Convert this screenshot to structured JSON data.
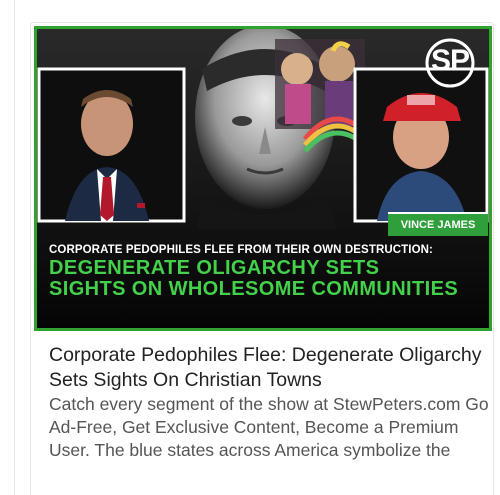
{
  "thumbnail": {
    "logo_text": "SP",
    "name_tag": "VINCE JAMES",
    "headline_line1": "CORPORATE PEDOPHILES FLEE FROM THEIR OWN DESTRUCTION:",
    "headline_line2": "DEGENERATE OLIGARCHY SETS",
    "headline_line3": "SIGHTS ON WHOLESOME COMMUNITIES",
    "colors": {
      "frame": "#2fa32f",
      "headline_green": "#43d04a",
      "name_tag_bg": "#2e9f3a"
    }
  },
  "card": {
    "title": "Corporate Pedophiles Flee: Degenerate Oligarchy Sets Sights On Christian Towns",
    "description": "Catch every segment of the show at StewPeters.com Go Ad-Free, Get Exclusive Content, Become a Premium User. The blue states across America symbolize the"
  }
}
